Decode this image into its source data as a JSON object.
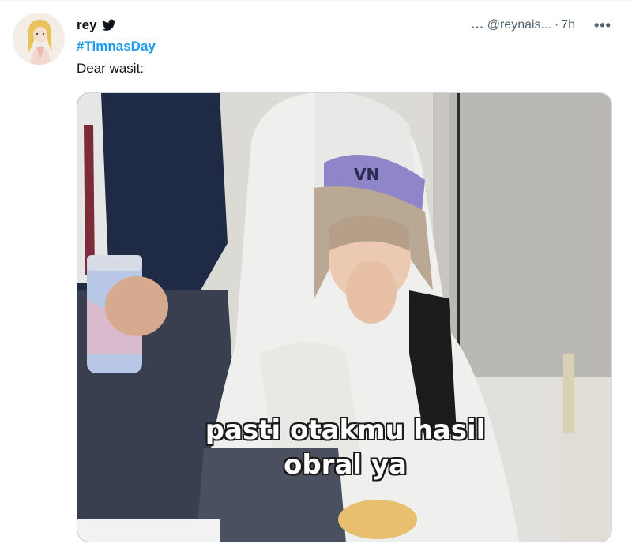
{
  "tweet": {
    "display_name": "rey",
    "handle": "@reynais...",
    "handle_prefix": "...",
    "time_separator": "·",
    "time": "7h",
    "hashtag": "#TimnasDay",
    "text": "Dear wasit:",
    "more_label": "•••"
  },
  "media": {
    "caption_line_1": "pasti otakmu hasil",
    "caption_line_2": "obral ya",
    "beanie_text": "VN"
  },
  "icons": {
    "bird": "twitter-bird-icon",
    "more": "more-options-icon",
    "avatar": "avatar-image"
  },
  "colors": {
    "link": "#1d9bf0",
    "text": "#0f1419",
    "secondary": "#536471",
    "background": "#ffffff"
  }
}
